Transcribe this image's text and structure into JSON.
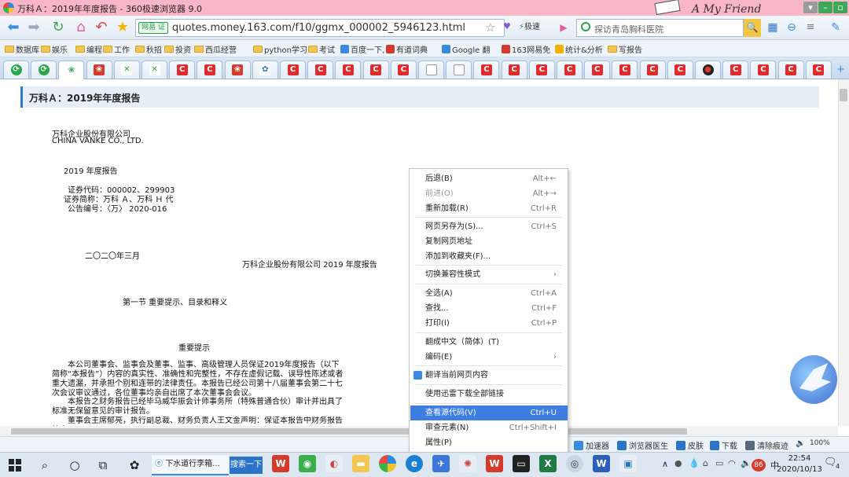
{
  "window": {
    "title": "万科Ａ：2019年年度报告 - 360极速浏览器 9.0",
    "deco_text": "A My Friend"
  },
  "navbar": {
    "site_badge": "网易 证",
    "url": "quotes.money.163.com/f10/ggmx_000002_5946123.html",
    "speed_label": "极速",
    "search_placeholder": "探访青岛胸科医院"
  },
  "bookmarks": [
    "数据库",
    "娱乐",
    "编程",
    "工作",
    "秋招",
    "投资",
    "西瓜经营",
    "python学习",
    "考试",
    "百度一下,",
    "有道词典",
    "Google 翻",
    "163网易免",
    "统计&分析",
    "写报告"
  ],
  "tabs": [
    "green",
    "green2",
    "flower",
    "163",
    "x",
    "x",
    "C",
    "C",
    "163",
    "paw",
    "C",
    "C",
    "C",
    "C",
    "C",
    "doc",
    "doc",
    "C",
    "C",
    "C",
    "C",
    "C",
    "C",
    "C",
    "C",
    "dark",
    "C",
    "C",
    "C",
    "C"
  ],
  "content": {
    "header_title": "万科Ａ：2019年年度报告",
    "company_cn": "万科企业股份有限公司",
    "company_en": "CHINA VANKE CO., LTD.",
    "report_title": "2019 年度报告",
    "code_line": "证券代码：000002、299903",
    "abbr_line": "证券简称：万科 Ａ、万科 Ｈ 代",
    "notice_line": "公告编号：〈万〉 2020-016",
    "date_line": "二〇二〇年三月",
    "running_header": "万科企业股份有限公司  2019 年度报告",
    "section1": "第一节  重要提示、目录和释义",
    "important": "重要提示",
    "para1": "　　本公司董事会、监事会及董事、监事、高级管理人员保证2019年度报告（以下简称“本报告”）内容的真实性、准确性和完整性，不存在虚假记载、误导性陈述或者重大遗漏，并承担个别和连带的法律责任。本报告已经公司第十八届董事会第二十七次会议审议通过，各位董事均亲自出席了本次董事会会议。",
    "para2": "　　本报告之财务报告已经毕马威华振会计师事务所（特殊普通合伙）审计并出具了标准无保留意见的审计报告。",
    "para3": "　　董事会主席郁亮，执行副总裁、财务负责人王文金声明：保证本报告中财务报告的真"
  },
  "context_menu": [
    {
      "label": "后退(B)",
      "shortcut": "Alt+←",
      "disabled": false
    },
    {
      "label": "前进(O)",
      "shortcut": "Alt+→",
      "disabled": true
    },
    {
      "label": "重新加载(R)",
      "shortcut": "Ctrl+R",
      "disabled": false
    },
    {
      "label": "网页另存为(S)...",
      "shortcut": "Ctrl+S",
      "disabled": false
    },
    {
      "label": "复制网页地址",
      "shortcut": "",
      "disabled": false
    },
    {
      "label": "添加到收藏夹(F)...",
      "shortcut": "",
      "disabled": false
    },
    {
      "label": "切换兼容性模式",
      "shortcut": "›",
      "disabled": false
    },
    {
      "label": "全选(A)",
      "shortcut": "Ctrl+A",
      "disabled": false
    },
    {
      "label": "查找...",
      "shortcut": "Ctrl+F",
      "disabled": false
    },
    {
      "label": "打印(I)",
      "shortcut": "Ctrl+P",
      "disabled": false
    },
    {
      "label": "翻成中文（简体）(T)",
      "shortcut": "",
      "disabled": false
    },
    {
      "label": "编码(E)",
      "shortcut": "›",
      "disabled": false
    },
    {
      "label": "翻译当前网页内容",
      "shortcut": "",
      "disabled": false
    },
    {
      "label": "使用迅雷下载全部链接",
      "shortcut": "",
      "disabled": false
    },
    {
      "label": "查看源代码(V)",
      "shortcut": "Ctrl+U",
      "disabled": false,
      "highlight": true
    },
    {
      "label": "审查元素(N)",
      "shortcut": "Ctrl+Shift+I",
      "disabled": false
    },
    {
      "label": "属性(P)",
      "shortcut": "",
      "disabled": false
    }
  ],
  "statusbar": {
    "accel": "加速器",
    "doctor": "浏览器医生",
    "skin": "皮肤",
    "download": "下载",
    "clean": "清除痕迹",
    "zoom": "100%"
  },
  "taskbar": {
    "app1": "下水道行李箱...",
    "search_btn": "搜索一下",
    "time": "22:54",
    "date": "2020/10/13",
    "lang": "中",
    "badge": "86",
    "notif": "4"
  }
}
